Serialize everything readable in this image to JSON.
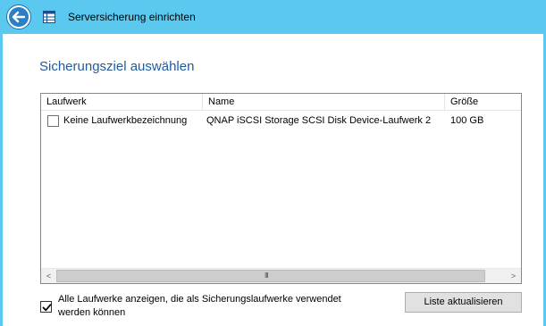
{
  "window": {
    "title": "Serversicherung einrichten",
    "accent_color": "#5bc8ef",
    "back_icon": "back-arrow-icon",
    "app_icon": "server-backup-icon"
  },
  "page": {
    "heading": "Sicherungsziel auswählen",
    "heading_color": "#1f5c9e"
  },
  "disk_list": {
    "columns": [
      "Laufwerk",
      "Name",
      "Größe"
    ],
    "rows": [
      {
        "checked": false,
        "drive": "Keine Laufwerkbezeichnung",
        "name": "QNAP iSCSI Storage SCSI Disk Device-Laufwerk 2",
        "size": "100 GB"
      }
    ],
    "scrollbar": {
      "left_arrow": "<",
      "right_arrow": ">",
      "grip": "III"
    }
  },
  "show_all": {
    "checked": true,
    "label": "Alle Laufwerke anzeigen, die als Sicherungslaufwerke verwendet werden können"
  },
  "refresh_button": {
    "label": "Liste aktualisieren"
  }
}
